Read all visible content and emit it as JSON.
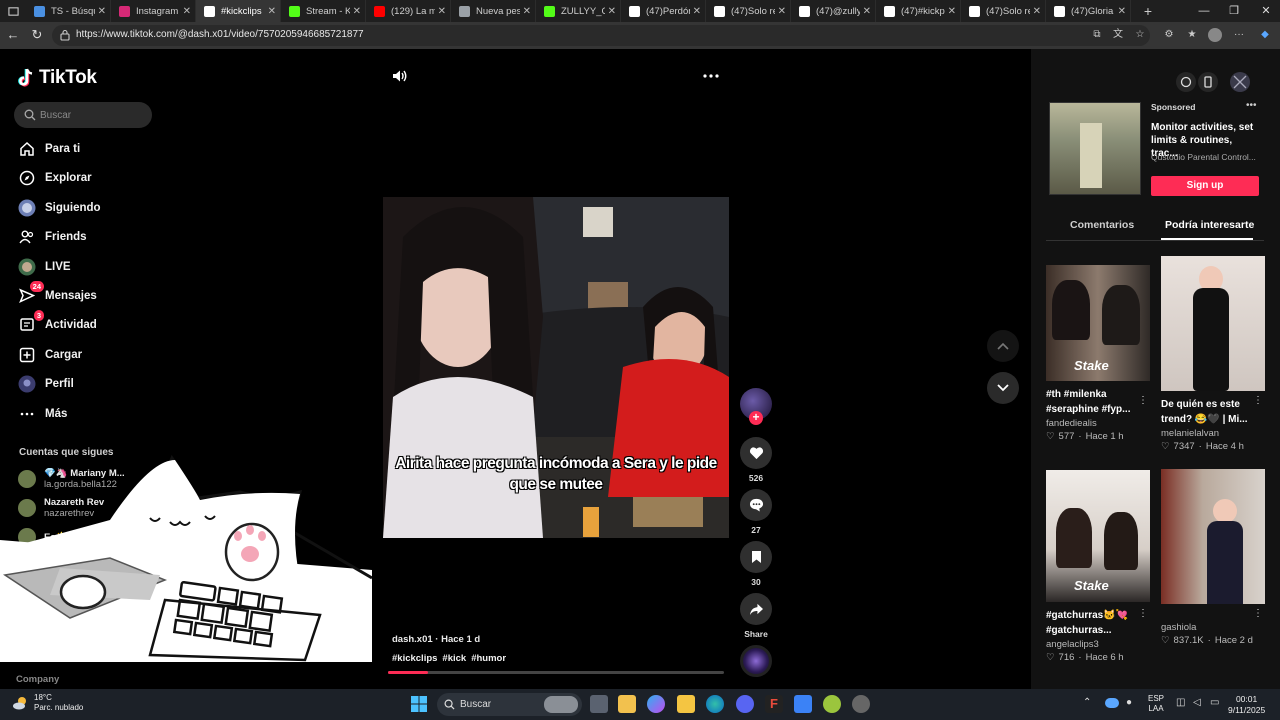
{
  "browser": {
    "tabs": [
      {
        "label": "TS - Búsqueda",
        "color": "#4a90e2",
        "active": false
      },
      {
        "label": "Instagram",
        "color": "#d62976",
        "active": false
      },
      {
        "label": "#kickclips",
        "color": "#ffffff",
        "active": true
      },
      {
        "label": "Stream - Kick",
        "color": "#53fc18",
        "active": false
      },
      {
        "label": "(129) La música",
        "color": "#ff0000",
        "active": false
      },
      {
        "label": "Nueva pestaña",
        "color": "#9aa0a6",
        "active": false
      },
      {
        "label": "ZULLYY_CS",
        "color": "#53fc18",
        "active": false
      },
      {
        "label": "(47)Perdóname",
        "color": "#ffffff",
        "active": false
      },
      {
        "label": "(47)Solo recuerdo",
        "color": "#ffffff",
        "active": false
      },
      {
        "label": "(47)@zullyy",
        "color": "#ffffff",
        "active": false
      },
      {
        "label": "(47)#kickperu",
        "color": "#ffffff",
        "active": false
      },
      {
        "label": "(47)Solo recuerdo",
        "color": "#ffffff",
        "active": false
      },
      {
        "label": "(47)Gloria Trevi",
        "color": "#ffffff",
        "active": false
      }
    ],
    "url": "https://www.tiktok.com/@dash.x01/video/7570205946685721877"
  },
  "sidebar": {
    "brand": "TikTok",
    "search_placeholder": "Buscar",
    "nav": [
      {
        "label": "Para ti",
        "icon": "home-icon"
      },
      {
        "label": "Explorar",
        "icon": "compass-icon"
      },
      {
        "label": "Siguiendo",
        "icon": "following-avatar-icon"
      },
      {
        "label": "Friends",
        "icon": "friends-icon"
      },
      {
        "label": "LIVE",
        "icon": "live-icon"
      },
      {
        "label": "Mensajes",
        "icon": "messages-icon",
        "badge": "24"
      },
      {
        "label": "Actividad",
        "icon": "activity-icon",
        "badge": "3"
      },
      {
        "label": "Cargar",
        "icon": "upload-icon"
      },
      {
        "label": "Perfil",
        "icon": "profile-icon"
      },
      {
        "label": "Más",
        "icon": "more-icon"
      }
    ],
    "following_title": "Cuentas que sigues",
    "accounts": [
      {
        "name": "💎🦄 Mariany M...",
        "handle": "la.gorda.bella122"
      },
      {
        "name": "Nazareth Rev",
        "handle": "nazarethrev"
      },
      {
        "name": "Es🌟lla",
        "handle": ""
      }
    ],
    "company": "Company"
  },
  "video": {
    "caption": "Airita hace pregunta incómoda a Sera y le pide que se mutee",
    "author_line": "dash.x01 · Hace 1 d",
    "tags": [
      "#kickclips",
      "#kick",
      "#humor"
    ],
    "progress": 0.12,
    "actions": {
      "likes": "526",
      "comments": "27",
      "saves": "30",
      "share": "Share"
    }
  },
  "right_panel": {
    "ad": {
      "sponsored": "Sponsored",
      "title": "Monitor activities, set limits & routines, trac...",
      "company": "Qustodio Parental Control...",
      "cta": "Sign up"
    },
    "tabs": [
      "Comentarios",
      "Podría interesarte"
    ],
    "cards": [
      {
        "title": "#th #milenka #seraphine #fyp...",
        "author": "fandediealis",
        "likes": "577",
        "time": "Hace 1 h",
        "badge": "Stake"
      },
      {
        "title": "De quién es este trend? 😂🖤 | Mi...",
        "author": "melanielalvan",
        "likes": "7347",
        "time": "Hace 4 h",
        "badge": ""
      },
      {
        "title": "#gatchurras🐱💘 #gatchurras...",
        "author": "angelaclips3",
        "likes": "716",
        "time": "Hace 6 h",
        "badge": "Stake"
      },
      {
        "title": "",
        "author": "gashiola",
        "likes": "837.1K",
        "time": "Hace 2 d",
        "badge": ""
      }
    ]
  },
  "taskbar": {
    "weather_temp": "18°C",
    "weather_desc": "Parc. nublado",
    "search_label": "Buscar",
    "lang_1": "ESP",
    "lang_2": "LAA",
    "time": "00:01",
    "date": "9/11/2025"
  }
}
